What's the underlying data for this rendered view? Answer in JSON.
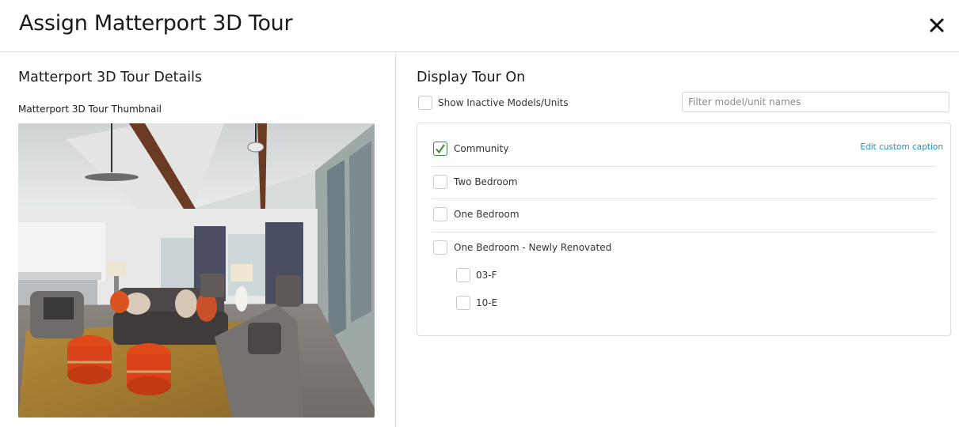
{
  "header": {
    "title": "Assign Matterport 3D Tour"
  },
  "left": {
    "heading": "Matterport 3D Tour Details",
    "thumbnail_label": "Matterport 3D Tour Thumbnail"
  },
  "right": {
    "heading": "Display Tour On",
    "show_inactive_label": "Show Inactive Models/Units",
    "show_inactive_checked": false,
    "filter_placeholder": "Filter model/unit names",
    "filter_value": "",
    "edit_caption_label": "Edit custom caption",
    "items": [
      {
        "label": "Community",
        "checked": true
      },
      {
        "label": "Two Bedroom",
        "checked": false
      },
      {
        "label": "One Bedroom",
        "checked": false
      },
      {
        "label": "One Bedroom - Newly Renovated",
        "checked": false
      },
      {
        "label": "03-F",
        "checked": false
      },
      {
        "label": "10-E",
        "checked": false
      }
    ]
  },
  "colors": {
    "check": "#3a8a3a",
    "link": "#1b8fc9",
    "border": "#dcdcdc"
  }
}
